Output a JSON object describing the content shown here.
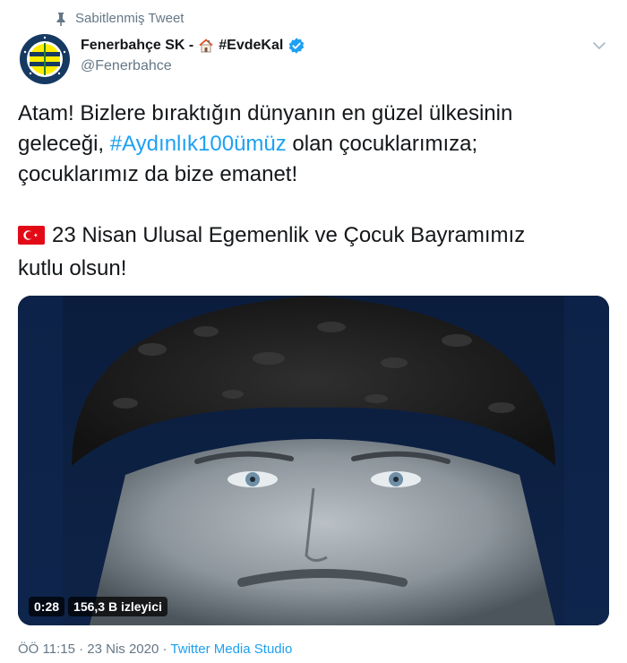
{
  "pinned": {
    "label": "Sabitlenmiş Tweet",
    "icon": "pin-icon"
  },
  "author": {
    "name": "Fenerbahçe SK -",
    "name_suffix": "#EvdeKal",
    "handle": "@Fenerbahce",
    "verified": true,
    "avatar_text": "FENERBAHÇE SPOR KULÜBÜ 1907"
  },
  "tweet": {
    "line1": "Atam! Bizlere bıraktığın dünyanın en güzel ülkesinin",
    "line2_pre": "geleceği, ",
    "hashtag": "#Aydınlık100ümüz",
    "line2_post": " olan çocuklarımıza;",
    "line3": "çocuklarımız da bize emanet!",
    "line4": "23 Nisan Ulusal Egemenlik ve Çocuk Bayramımız",
    "line5": "kutlu olsun!"
  },
  "video": {
    "duration": "0:28",
    "views": "156,3 B izleyici"
  },
  "meta": {
    "time": "ÖÖ 11:15",
    "separator1": " · ",
    "date": "23 Nis 2020",
    "separator2": " · ",
    "source": "Twitter Media Studio"
  },
  "colors": {
    "link": "#1da1f2",
    "secondary_text": "#657786",
    "verified": "#1da1f2",
    "flag_red": "#e30a17",
    "club_yellow": "#ffed00",
    "club_navy": "#163962"
  }
}
